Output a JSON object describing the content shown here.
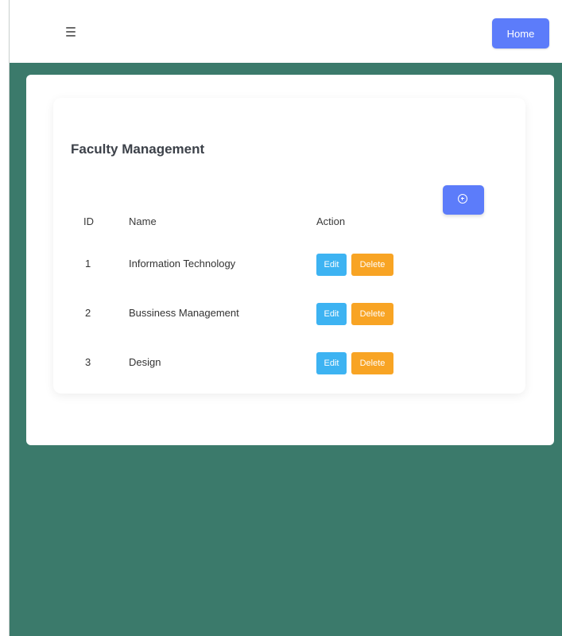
{
  "navbar": {
    "menu_icon": "hamburger-icon",
    "home_label": "Home"
  },
  "card": {
    "title": "Faculty Management",
    "add_icon": "plus-circle-icon"
  },
  "table": {
    "headers": {
      "id": "ID",
      "name": "Name",
      "action": "Action"
    },
    "rows": [
      {
        "id": "1",
        "name": "Information Technology",
        "edit": "Edit",
        "delete": "Delete"
      },
      {
        "id": "2",
        "name": "Bussiness Management",
        "edit": "Edit",
        "delete": "Delete"
      },
      {
        "id": "3",
        "name": "Design",
        "edit": "Edit",
        "delete": "Delete"
      }
    ]
  },
  "colors": {
    "background": "#3b7a6b",
    "primary": "#5c7cfa",
    "edit": "#3db3f2",
    "delete": "#f8a424"
  }
}
